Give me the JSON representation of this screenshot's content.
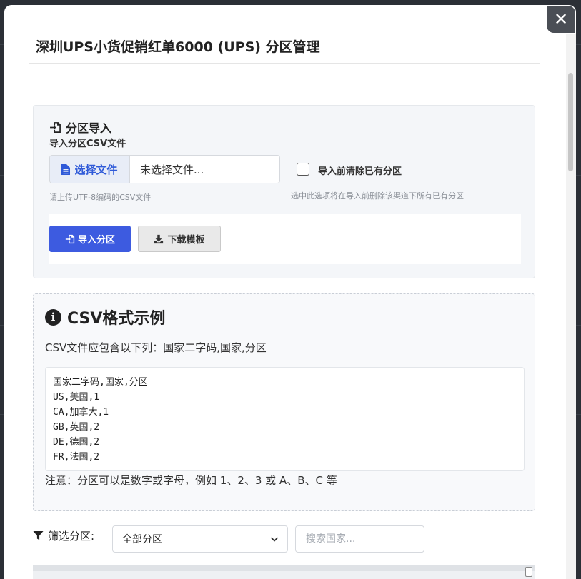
{
  "modal": {
    "title": "深圳UPS小货促销红单6000 (UPS) 分区管理",
    "close_icon": "close-icon"
  },
  "import": {
    "heading": "分区导入",
    "field_label": "导入分区CSV文件",
    "choose_file_label": "选择文件",
    "no_file_text": "未选择文件...",
    "file_hint": "请上传UTF-8编码的CSV文件",
    "clear_checkbox_label": "导入前清除已有分区",
    "clear_checkbox_checked": false,
    "clear_hint": "选中此选项将在导入前删除该渠道下所有已有分区",
    "import_button": "导入分区",
    "download_button": "下载模板",
    "accent_color": "#3d5be0"
  },
  "csv_example": {
    "heading": "CSV格式示例",
    "description": "CSV文件应包含以下列：国家二字码,国家,分区",
    "lines": [
      "国家二字码,国家,分区",
      "US,美国,1",
      "CA,加拿大,1",
      "GB,英国,2",
      "DE,德国,2",
      "FR,法国,2"
    ],
    "note": "注意：分区可以是数字或字母，例如 1、2、3 或 A、B、C 等"
  },
  "filter": {
    "label": "筛选分区:",
    "select_value": "全部分区",
    "search_placeholder": "搜索国家..."
  }
}
